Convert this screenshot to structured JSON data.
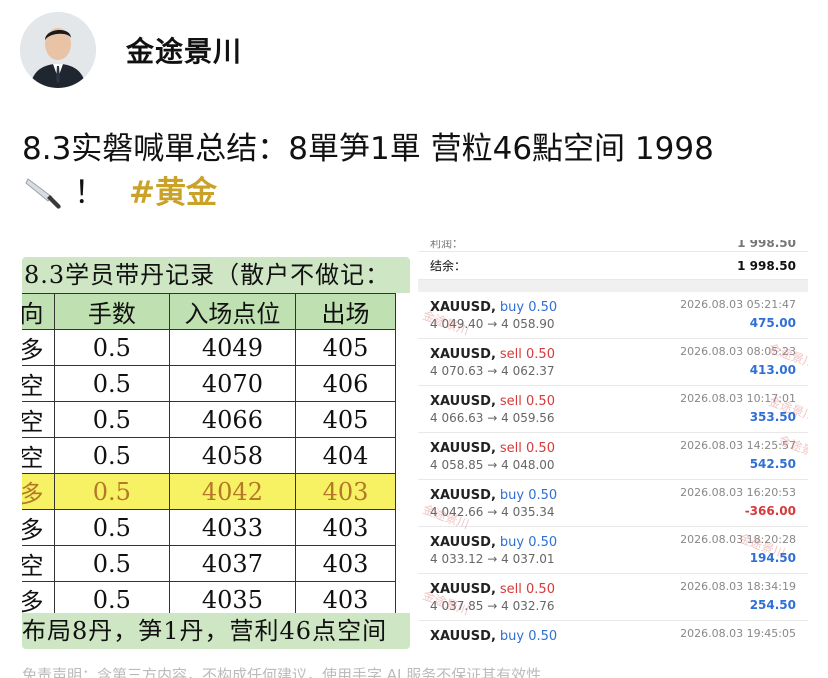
{
  "author": {
    "name": "金途景川"
  },
  "post": {
    "line1": "8.3实磐喊單总结：8單笋1單 营粒46點空间 1998",
    "line2_punct": "！",
    "hashtag": "#黄金"
  },
  "record_table": {
    "title": "8.3学员带丹记录（散户不做记：",
    "headers": [
      "向",
      "手数",
      "入场点位",
      "出场"
    ],
    "rows": [
      [
        "多",
        "0.5",
        "4049",
        "405"
      ],
      [
        "空",
        "0.5",
        "4070",
        "406"
      ],
      [
        "空",
        "0.5",
        "4066",
        "405"
      ],
      [
        "空",
        "0.5",
        "4058",
        "404"
      ],
      [
        "多",
        "0.5",
        "4042",
        "403"
      ],
      [
        "多",
        "0.5",
        "4033",
        "403"
      ],
      [
        "空",
        "0.5",
        "4037",
        "403"
      ],
      [
        "多",
        "0.5",
        "4035",
        "403"
      ]
    ],
    "highlight_row": 4,
    "footer": "布局8丹，笋1丹，营利46点空间"
  },
  "trade_list": {
    "top_label": "利润：",
    "top_value": "1 998.50",
    "balance_label": "结余：",
    "balance_value": "1 998.50",
    "watermark": "金途景川",
    "trades": [
      {
        "symbol": "XAUUSD,",
        "side": "buy 0.50",
        "dir": "buy",
        "prices": "4 049.40 → 4 058.90",
        "time": "2026.08.03 05:21:47",
        "pl": "475.00",
        "sign": "pos"
      },
      {
        "symbol": "XAUUSD,",
        "side": "sell 0.50",
        "dir": "sell",
        "prices": "4 070.63 → 4 062.37",
        "time": "2026.08.03 08:05:23",
        "pl": "413.00",
        "sign": "pos"
      },
      {
        "symbol": "XAUUSD,",
        "side": "sell 0.50",
        "dir": "sell",
        "prices": "4 066.63 → 4 059.56",
        "time": "2026.08.03 10:17:01",
        "pl": "353.50",
        "sign": "pos"
      },
      {
        "symbol": "XAUUSD,",
        "side": "sell 0.50",
        "dir": "sell",
        "prices": "4 058.85 → 4 048.00",
        "time": "2026.08.03 14:25:57",
        "pl": "542.50",
        "sign": "pos"
      },
      {
        "symbol": "XAUUSD,",
        "side": "buy 0.50",
        "dir": "buy",
        "prices": "4 042.66 → 4 035.34",
        "time": "2026.08.03 16:20:53",
        "pl": "-366.00",
        "sign": "neg"
      },
      {
        "symbol": "XAUUSD,",
        "side": "buy 0.50",
        "dir": "buy",
        "prices": "4 033.12 → 4 037.01",
        "time": "2026.08.03 18:20:28",
        "pl": "194.50",
        "sign": "pos"
      },
      {
        "symbol": "XAUUSD,",
        "side": "sell 0.50",
        "dir": "sell",
        "prices": "4 037.85 → 4 032.76",
        "time": "2026.08.03 18:34:19",
        "pl": "254.50",
        "sign": "pos"
      },
      {
        "symbol": "XAUUSD,",
        "side": "buy 0.50",
        "dir": "buy",
        "prices": "",
        "time": "2026.08.03 19:45:05",
        "pl": "",
        "sign": "pos"
      }
    ]
  },
  "disclaimer": "免责声明：含第三方内容，不构成任何建议，使用手字 AI 服务不保证其有效性",
  "colors": {
    "hashtag": "#c9a227",
    "buy": "#2f6fd6",
    "sell": "#d63a3a",
    "highlight": "#f7f263",
    "table_header": "#bfe0b0"
  }
}
